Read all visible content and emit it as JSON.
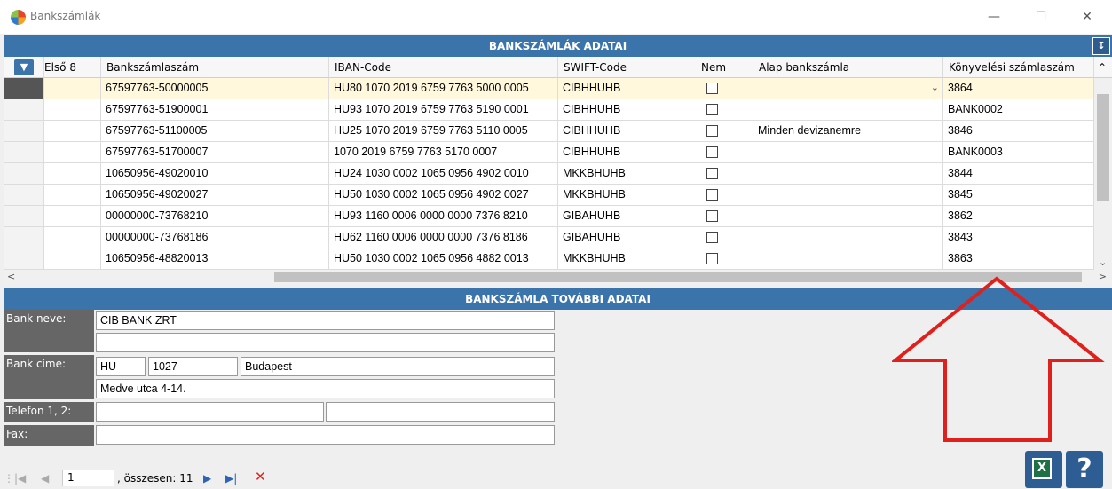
{
  "window": {
    "title": "Bankszámlák",
    "minimize": "—",
    "maximize": "☐",
    "close": "✕"
  },
  "grid_section": {
    "header": "BANKSZÁMLÁK ADATAI",
    "collapse_icon": "↧"
  },
  "columns": [
    {
      "label": "Első 8"
    },
    {
      "label": "Bankszámlaszám"
    },
    {
      "label": "IBAN-Code"
    },
    {
      "label": "SWIFT-Code"
    },
    {
      "label": "Nem"
    },
    {
      "label": "Alap bankszámla"
    },
    {
      "label": "Könyvelési számlaszám"
    }
  ],
  "rows": [
    {
      "acct": "67597763-50000005",
      "iban": "HU80 1070 2019 6759 7763 5000 0005",
      "swift": "CIBHHUHB",
      "alap": "",
      "konyv": "3864",
      "selected": true
    },
    {
      "acct": "67597763-51900001",
      "iban": "HU93 1070 2019 6759 7763 5190 0001",
      "swift": "CIBHHUHB",
      "alap": "",
      "konyv": "BANK0002"
    },
    {
      "acct": "67597763-51100005",
      "iban": "HU25 1070 2019 6759 7763 5110 0005",
      "swift": "CIBHHUHB",
      "alap": "Minden devizanemre",
      "konyv": "3846"
    },
    {
      "acct": "67597763-51700007",
      "iban": "1070 2019 6759 7763 5170 0007",
      "swift": "CIBHHUHB",
      "alap": "",
      "konyv": "BANK0003"
    },
    {
      "acct": "10650956-49020010",
      "iban": "HU24 1030 0002 1065 0956 4902 0010",
      "swift": "MKKBHUHB",
      "alap": "",
      "konyv": "3844"
    },
    {
      "acct": "10650956-49020027",
      "iban": "HU50 1030 0002 1065 0956 4902 0027",
      "swift": "MKKBHUHB",
      "alap": "",
      "konyv": "3845"
    },
    {
      "acct": "00000000-73768210",
      "iban": "HU93 1160 0006 0000 0000 7376 8210",
      "swift": "GIBAHUHB",
      "alap": "",
      "konyv": "3862"
    },
    {
      "acct": "00000000-73768186",
      "iban": "HU62 1160 0006 0000 0000 7376 8186",
      "swift": "GIBAHUHB",
      "alap": "",
      "konyv": "3843"
    },
    {
      "acct": "10650956-48820013",
      "iban": "HU50 1030 0002 1065 0956 4882 0013",
      "swift": "MKKBHUHB",
      "alap": "",
      "konyv": "3863"
    }
  ],
  "details": {
    "header": "BANKSZÁMLA TOVÁBBI ADATAI",
    "bank_name_label": "Bank neve:",
    "bank_name": "CIB BANK ZRT",
    "bank_name_2": "",
    "address_label": "Bank címe:",
    "country": "HU",
    "zip": "1027",
    "city": "Budapest",
    "street": "Medve utca 4-14.",
    "phone_label": "Telefon 1, 2:",
    "phone1": "",
    "phone2": "",
    "fax_label": "Fax:",
    "fax": ""
  },
  "pager": {
    "first": "|◀",
    "prev": "◀",
    "page": "1",
    "total": ", összesen: 11",
    "next": "▶",
    "last": "▶|",
    "delete": "✕"
  },
  "colors": {
    "header_blue": "#3b73ab",
    "selected_row": "#fff8dc",
    "arrow_red": "#e0201c"
  },
  "buttons": {
    "help": "?"
  }
}
